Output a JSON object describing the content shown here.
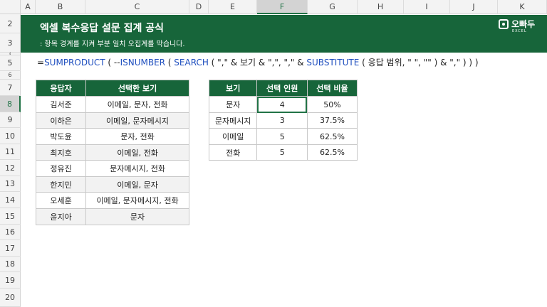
{
  "columns": [
    "A",
    "B",
    "C",
    "D",
    "E",
    "F",
    "G",
    "H",
    "I",
    "J",
    "K"
  ],
  "rows": [
    "2",
    "3",
    "4",
    "5",
    "6",
    "7",
    "8",
    "9",
    "10",
    "11",
    "12",
    "13",
    "14",
    "15",
    "16",
    "17",
    "18",
    "19",
    "20"
  ],
  "banner": {
    "title": "엑셀 복수응답 설문 집계 공식",
    "subtitle": ": 항목 경계를 지켜 부분 일치 오집계를 막습니다.",
    "logo_text": "오빠두",
    "logo_sub": "EXCEL"
  },
  "formula": {
    "p1": "=",
    "f1": "SUMPRODUCT",
    "p2": " ( --",
    "f2": "ISNUMBER",
    "p3": " ( ",
    "f3": "SEARCH",
    "p4": " ( \",\" & 보기 & \",\", \",\" & ",
    "f4": "SUBSTITUTE",
    "p5": " ( 응답 범위, \" \", \"\" ) & \",\" ) ) )"
  },
  "left_table": {
    "headers": [
      "응답자",
      "선택한 보기"
    ],
    "rows": [
      [
        "김서준",
        "이메일, 문자, 전화"
      ],
      [
        "이하은",
        "이메일, 문자메시지"
      ],
      [
        "박도윤",
        "문자, 전화"
      ],
      [
        "최지호",
        "이메일, 전화"
      ],
      [
        "정유진",
        "문자메시지, 전화"
      ],
      [
        "한지민",
        "이메일, 문자"
      ],
      [
        "오세훈",
        "이메일, 문자메시지, 전화"
      ],
      [
        "윤지아",
        "문자"
      ]
    ]
  },
  "right_table": {
    "headers": [
      "보기",
      "선택 인원",
      "선택 비율"
    ],
    "rows": [
      [
        "문자",
        "4",
        "50%"
      ],
      [
        "문자메시지",
        "3",
        "37.5%"
      ],
      [
        "이메일",
        "5",
        "62.5%"
      ],
      [
        "전화",
        "5",
        "62.5%"
      ]
    ]
  },
  "colors": {
    "header_green": "#17653a",
    "selection": "#217346",
    "function_blue": "#1f4fbf"
  }
}
